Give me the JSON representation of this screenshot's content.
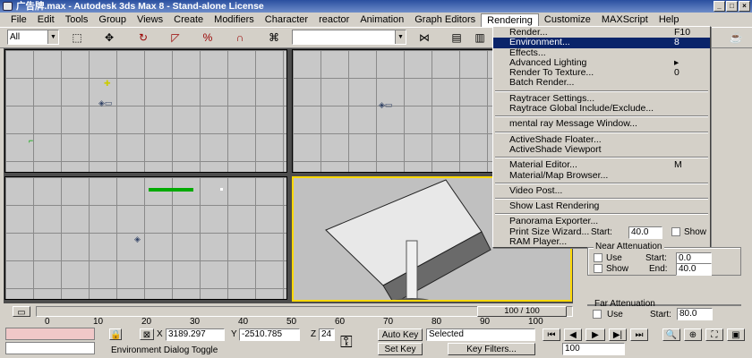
{
  "window": {
    "title": "广告牌.max - Autodesk 3ds Max 8  - Stand-alone License"
  },
  "menu": [
    "File",
    "Edit",
    "Tools",
    "Group",
    "Views",
    "Create",
    "Modifiers",
    "Character",
    "reactor",
    "Animation",
    "Graph Editors",
    "Rendering",
    "Customize",
    "MAXScript",
    "Help"
  ],
  "toolbar": {
    "selection_filter": "All",
    "named_selection": ""
  },
  "rendering_menu": [
    {
      "label": "Render...",
      "shortcut": "F10"
    },
    {
      "label": "Environment...",
      "shortcut": "8",
      "highlight": true
    },
    {
      "label": "Effects...",
      "shortcut": ""
    },
    {
      "label": "Advanced Lighting",
      "shortcut": "▸"
    },
    {
      "label": "Render To Texture...",
      "shortcut": "0"
    },
    {
      "label": "Batch Render...",
      "shortcut": ""
    },
    {
      "sep": true
    },
    {
      "label": "Raytracer Settings...",
      "shortcut": ""
    },
    {
      "label": "Raytrace Global Include/Exclude...",
      "shortcut": ""
    },
    {
      "sep": true
    },
    {
      "label": "mental ray Message Window...",
      "shortcut": ""
    },
    {
      "sep": true
    },
    {
      "label": "ActiveShade Floater...",
      "shortcut": ""
    },
    {
      "label": "ActiveShade Viewport",
      "shortcut": ""
    },
    {
      "sep": true
    },
    {
      "label": "Material Editor...",
      "shortcut": "M"
    },
    {
      "label": "Material/Map Browser...",
      "shortcut": ""
    },
    {
      "sep": true
    },
    {
      "label": "Video Post...",
      "shortcut": ""
    },
    {
      "sep": true
    },
    {
      "label": "Show Last Rendering",
      "shortcut": ""
    },
    {
      "sep": true
    },
    {
      "label": "Panorama Exporter...",
      "shortcut": ""
    },
    {
      "label": "Print Size Wizard...",
      "shortcut": ""
    },
    {
      "label": "RAM Player...",
      "shortcut": ""
    }
  ],
  "timeline": {
    "frame_display": "100 / 100",
    "ticks": [
      "0",
      "10",
      "20",
      "30",
      "40",
      "50",
      "60",
      "70",
      "80",
      "90",
      "100"
    ]
  },
  "status": {
    "x_label": "X",
    "x": "3189.297",
    "y_label": "Y",
    "y": "-2510.785",
    "z_label": "Z",
    "z": "24",
    "prompt": "Environment Dialog Toggle",
    "auto_key": "Auto Key",
    "set_key": "Set Key",
    "key_mode": "Selected",
    "key_filters": "Key Filters...",
    "frame": "100"
  },
  "panel": {
    "start_label": "Start:",
    "start": "40.0",
    "show": "Show",
    "near": "Near Attenuation",
    "use": "Use",
    "start2": "0.0",
    "show2": "Show",
    "end_label": "End:",
    "end": "40.0",
    "far": "Far Attenuation",
    "use2": "Use",
    "start3": "80.0"
  }
}
